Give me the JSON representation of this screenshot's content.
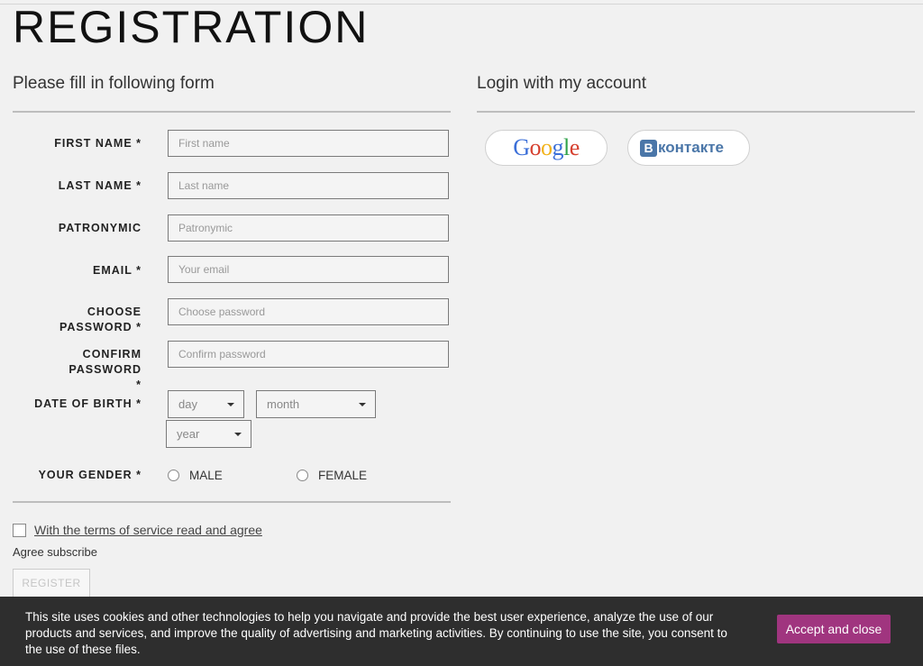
{
  "page": {
    "title": "REGISTRATION"
  },
  "form": {
    "heading": "Please fill in following form",
    "fields": {
      "first_name": {
        "label": "FIRST NAME *",
        "placeholder": "First name"
      },
      "last_name": {
        "label": "LAST NAME *",
        "placeholder": "Last name"
      },
      "patronymic": {
        "label": "PATRONYMIC",
        "placeholder": "Patronymic"
      },
      "email": {
        "label": "EMAIL *",
        "placeholder": "Your email"
      },
      "password": {
        "label": "CHOOSE PASSWORD *",
        "placeholder": "Choose password"
      },
      "confirm_password": {
        "label_line1": "CONFIRM PASSWORD",
        "label_line2": "*",
        "placeholder": "Confirm password"
      }
    },
    "dob": {
      "label": "DATE OF BIRTH *",
      "day": "day",
      "month": "month",
      "year": "year"
    },
    "gender": {
      "label": "YOUR GENDER *",
      "male": "MALE",
      "female": "FEMALE"
    },
    "terms_label": "With the terms of service read and agree",
    "subscribe_label": "Agree subscribe",
    "register_button": "REGISTER"
  },
  "social": {
    "heading": "Login with my account",
    "google": {
      "letters": [
        "G",
        "o",
        "o",
        "g",
        "l",
        "e"
      ],
      "colors": [
        "#3b6fd8",
        "#d6402f",
        "#f2b219",
        "#3b6fd8",
        "#2fa24a",
        "#d6402f"
      ]
    },
    "vk": {
      "badge": "В",
      "text": "контакте",
      "color": "#4a76a8"
    }
  },
  "cookie": {
    "text": "This site uses cookies and other technologies to help you navigate and provide the best user experience, analyze the use of our products and services, and improve the quality of advertising and marketing activities. By continuing to use the site, you consent to the use of these files.",
    "button": "Accept and close",
    "button_color": "#a0357f"
  }
}
